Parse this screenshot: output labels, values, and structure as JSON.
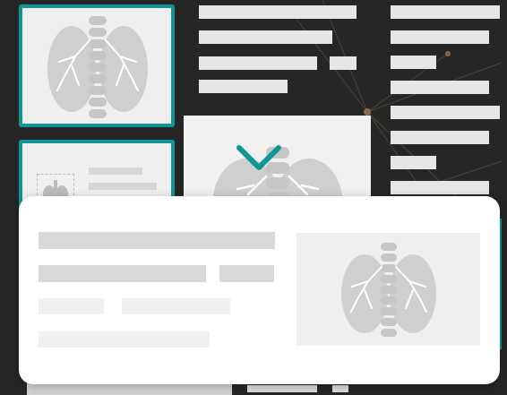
{
  "colors": {
    "background": "#272626",
    "accent_teal": "#0f9696",
    "placeholder_light": "#e6e6e6",
    "placeholder_card": "#d9d9d9",
    "placeholder_faint": "#f0f0f0",
    "lung_fill": "#cfcfcf"
  },
  "icons": {
    "chevron": "chevron-down-icon",
    "lungs": "lungs-xray-icon",
    "lung_small": "lungs-small-icon"
  },
  "gallery": {
    "thumbnails": [
      {
        "name": "thumbnail-1",
        "selected": true
      },
      {
        "name": "thumbnail-2",
        "selected": true
      }
    ]
  },
  "overlay": {
    "kind": "card-preview"
  }
}
